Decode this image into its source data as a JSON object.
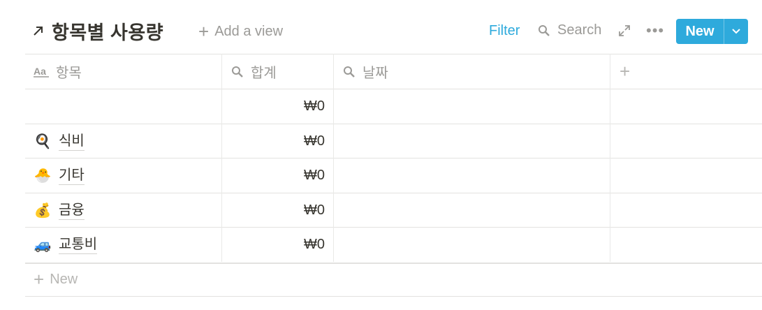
{
  "header": {
    "title": "항목별 사용량",
    "add_view": "Add a view",
    "filter": "Filter",
    "search": "Search",
    "new_button": "New"
  },
  "columns": [
    {
      "label": "항목",
      "icon": "text-property-icon"
    },
    {
      "label": "합계",
      "icon": "formula-search-icon"
    },
    {
      "label": "날짜",
      "icon": "formula-search-icon"
    },
    {
      "label": "",
      "icon": "plus-icon"
    }
  ],
  "rows": [
    {
      "name": "",
      "total": "₩0",
      "emoji": "",
      "icon": ""
    },
    {
      "name": "식비",
      "total": "₩0",
      "emoji": "🍳",
      "icon": "frying-pan-icon"
    },
    {
      "name": "기타",
      "total": "₩0",
      "emoji": "🐣",
      "icon": "hatching-chick-icon"
    },
    {
      "name": "금융",
      "total": "₩0",
      "emoji": "💰",
      "icon": "money-bag-icon"
    },
    {
      "name": "교통비",
      "total": "₩0",
      "emoji": "🚙",
      "icon": "car-icon"
    }
  ],
  "footer": {
    "new_label": "New"
  },
  "colors": {
    "accent": "#2eaadc",
    "muted": "#9b9a97",
    "text": "#37352f"
  }
}
